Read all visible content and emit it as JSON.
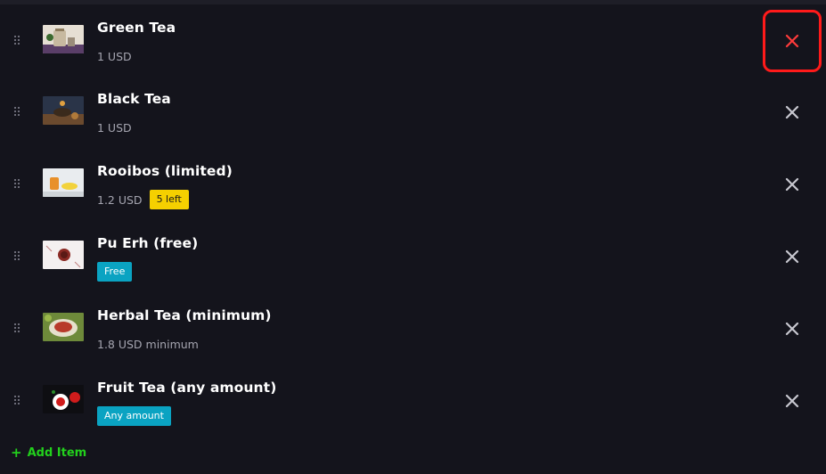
{
  "items": [
    {
      "title": "Green Tea",
      "price": "1 USD",
      "badge": "",
      "icons": {
        "drag": "drag-handle-icon",
        "remove": "close-icon"
      },
      "remove_color": "#ff3b3b"
    },
    {
      "title": "Black Tea",
      "price": "1 USD",
      "badge": "",
      "icons": {
        "drag": "drag-handle-icon",
        "remove": "close-icon"
      },
      "remove_color": "#c8c8d0"
    },
    {
      "title": "Rooibos (limited)",
      "price": "1.2 USD",
      "badge": "5 left",
      "badge_color": "#f5d000",
      "icons": {
        "drag": "drag-handle-icon",
        "remove": "close-icon"
      },
      "remove_color": "#c8c8d0"
    },
    {
      "title": "Pu Erh (free)",
      "price": "",
      "badge": "Free",
      "badge_color": "#0aa3c2",
      "icons": {
        "drag": "drag-handle-icon",
        "remove": "close-icon"
      },
      "remove_color": "#c8c8d0"
    },
    {
      "title": "Herbal Tea (minimum)",
      "price": "1.8 USD minimum",
      "badge": "",
      "icons": {
        "drag": "drag-handle-icon",
        "remove": "close-icon"
      },
      "remove_color": "#c8c8d0"
    },
    {
      "title": "Fruit Tea (any amount)",
      "price": "",
      "badge": "Any amount",
      "badge_color": "#0aa3c2",
      "icons": {
        "drag": "drag-handle-icon",
        "remove": "close-icon"
      },
      "remove_color": "#c8c8d0"
    }
  ],
  "add_item": {
    "label": "Add Item",
    "icon": "plus-icon",
    "color": "#22d01c"
  },
  "highlight": {
    "color": "#ff1a1a",
    "target": "Green Tea remove button"
  },
  "theme": {
    "background": "#14141c",
    "text": "#ffffff",
    "muted": "#a5a5b0"
  }
}
